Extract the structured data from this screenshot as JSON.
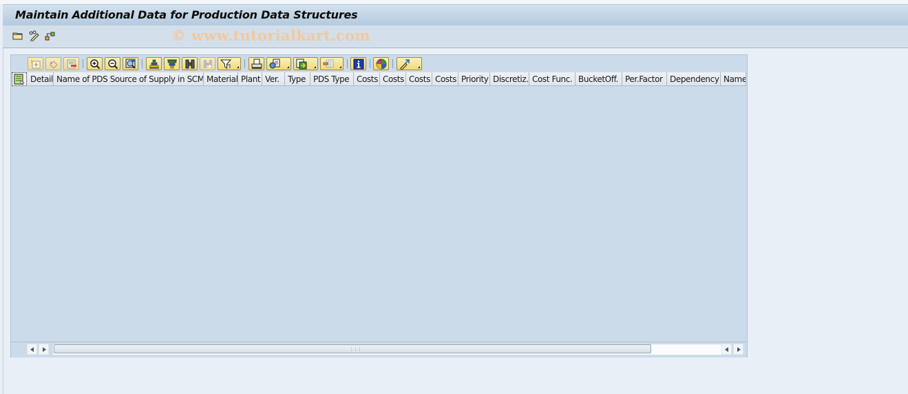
{
  "window": {
    "title": "Maintain Additional Data for Production Data Structures",
    "watermark": "© www.tutorialkart.com"
  },
  "app_toolbar": {
    "buttons": [
      {
        "name": "open-folder",
        "icon": "folder-icon"
      },
      {
        "name": "change",
        "icon": "pencil-glasses-icon"
      },
      {
        "name": "hierarchy",
        "icon": "hierarchy-icon"
      }
    ]
  },
  "grid_toolbar": {
    "buttons": [
      {
        "name": "append-row",
        "icon": "append-row-icon",
        "enabled": false
      },
      {
        "name": "undo",
        "icon": "undo-icon",
        "enabled": false
      },
      {
        "name": "delete-row",
        "icon": "delete-row-icon",
        "enabled": false
      },
      {
        "name": "zoom-in",
        "icon": "zoom-in-icon",
        "enabled": true
      },
      {
        "name": "zoom-out",
        "icon": "zoom-out-icon",
        "enabled": true
      },
      {
        "name": "details",
        "icon": "details-icon",
        "enabled": true
      },
      {
        "name": "sort-ascending",
        "icon": "sort-ascending-icon",
        "enabled": true
      },
      {
        "name": "sort-descending",
        "icon": "sort-descending-icon",
        "enabled": true
      },
      {
        "name": "find",
        "icon": "binoculars-icon",
        "enabled": true
      },
      {
        "name": "find-next",
        "icon": "find-next-icon",
        "enabled": false
      },
      {
        "name": "filter",
        "icon": "filter-icon",
        "enabled": true,
        "dropdown": true
      },
      {
        "name": "print",
        "icon": "printer-icon",
        "enabled": true
      },
      {
        "name": "views",
        "icon": "views-icon",
        "enabled": true,
        "dropdown": true
      },
      {
        "name": "export",
        "icon": "export-icon",
        "enabled": true,
        "dropdown": true
      },
      {
        "name": "layout",
        "icon": "layout-icon",
        "enabled": true,
        "dropdown": true
      },
      {
        "name": "information",
        "icon": "info-icon",
        "enabled": true
      },
      {
        "name": "graphic",
        "icon": "graphic-icon",
        "enabled": true
      },
      {
        "name": "change-mode",
        "icon": "pencil-arrow-icon",
        "enabled": true,
        "dropdown": true
      }
    ]
  },
  "grid": {
    "columns": [
      "Detail",
      "Name of PDS Source of Supply in SCM",
      "Material",
      "Plant",
      "Ver.",
      "Type",
      "PDS Type",
      "Costs",
      "Costs",
      "Costs",
      "Costs",
      "Priority",
      "Discretiz.",
      "Cost Func.",
      "BucketOff.",
      "Per.Factor",
      "Dependency",
      "Name"
    ],
    "rows": []
  }
}
